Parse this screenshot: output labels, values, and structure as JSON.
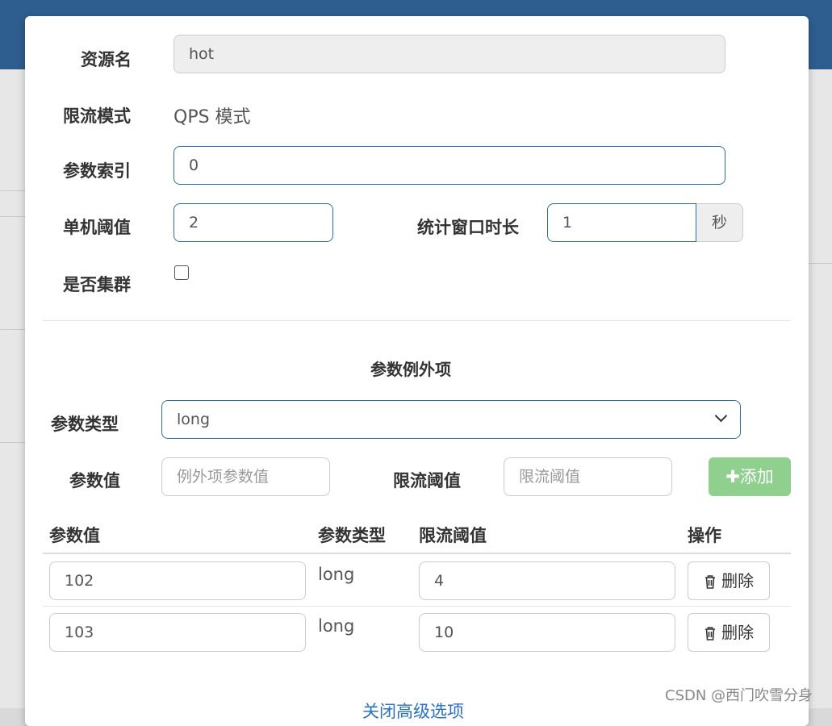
{
  "form": {
    "resource_label": "资源名",
    "resource_value": "hot",
    "mode_label": "限流模式",
    "mode_value": "QPS 模式",
    "param_index_label": "参数索引",
    "param_index_value": "0",
    "threshold_label": "单机阈值",
    "threshold_value": "2",
    "window_label": "统计窗口时长",
    "window_value": "1",
    "window_unit": "秒",
    "cluster_label": "是否集群",
    "cluster_checked": false
  },
  "exceptions": {
    "section_title": "参数例外项",
    "type_label": "参数类型",
    "type_selected": "long",
    "value_label": "参数值",
    "value_placeholder": "例外项参数值",
    "limit_label": "限流阈值",
    "limit_placeholder": "限流阈值",
    "add_button": "添加",
    "table": {
      "headers": [
        "参数值",
        "参数类型",
        "限流阈值",
        "操作"
      ],
      "rows": [
        {
          "value": "102",
          "type": "long",
          "limit": "4",
          "action": "删除"
        },
        {
          "value": "103",
          "type": "long",
          "limit": "10",
          "action": "删除"
        }
      ]
    }
  },
  "footer_link": "关闭高级选项",
  "watermark": "CSDN @西门吹雪分身",
  "colors": {
    "focus_border": "#2e6da4",
    "add_button_bg": "#8fd08f",
    "link": "#2a72c2"
  }
}
